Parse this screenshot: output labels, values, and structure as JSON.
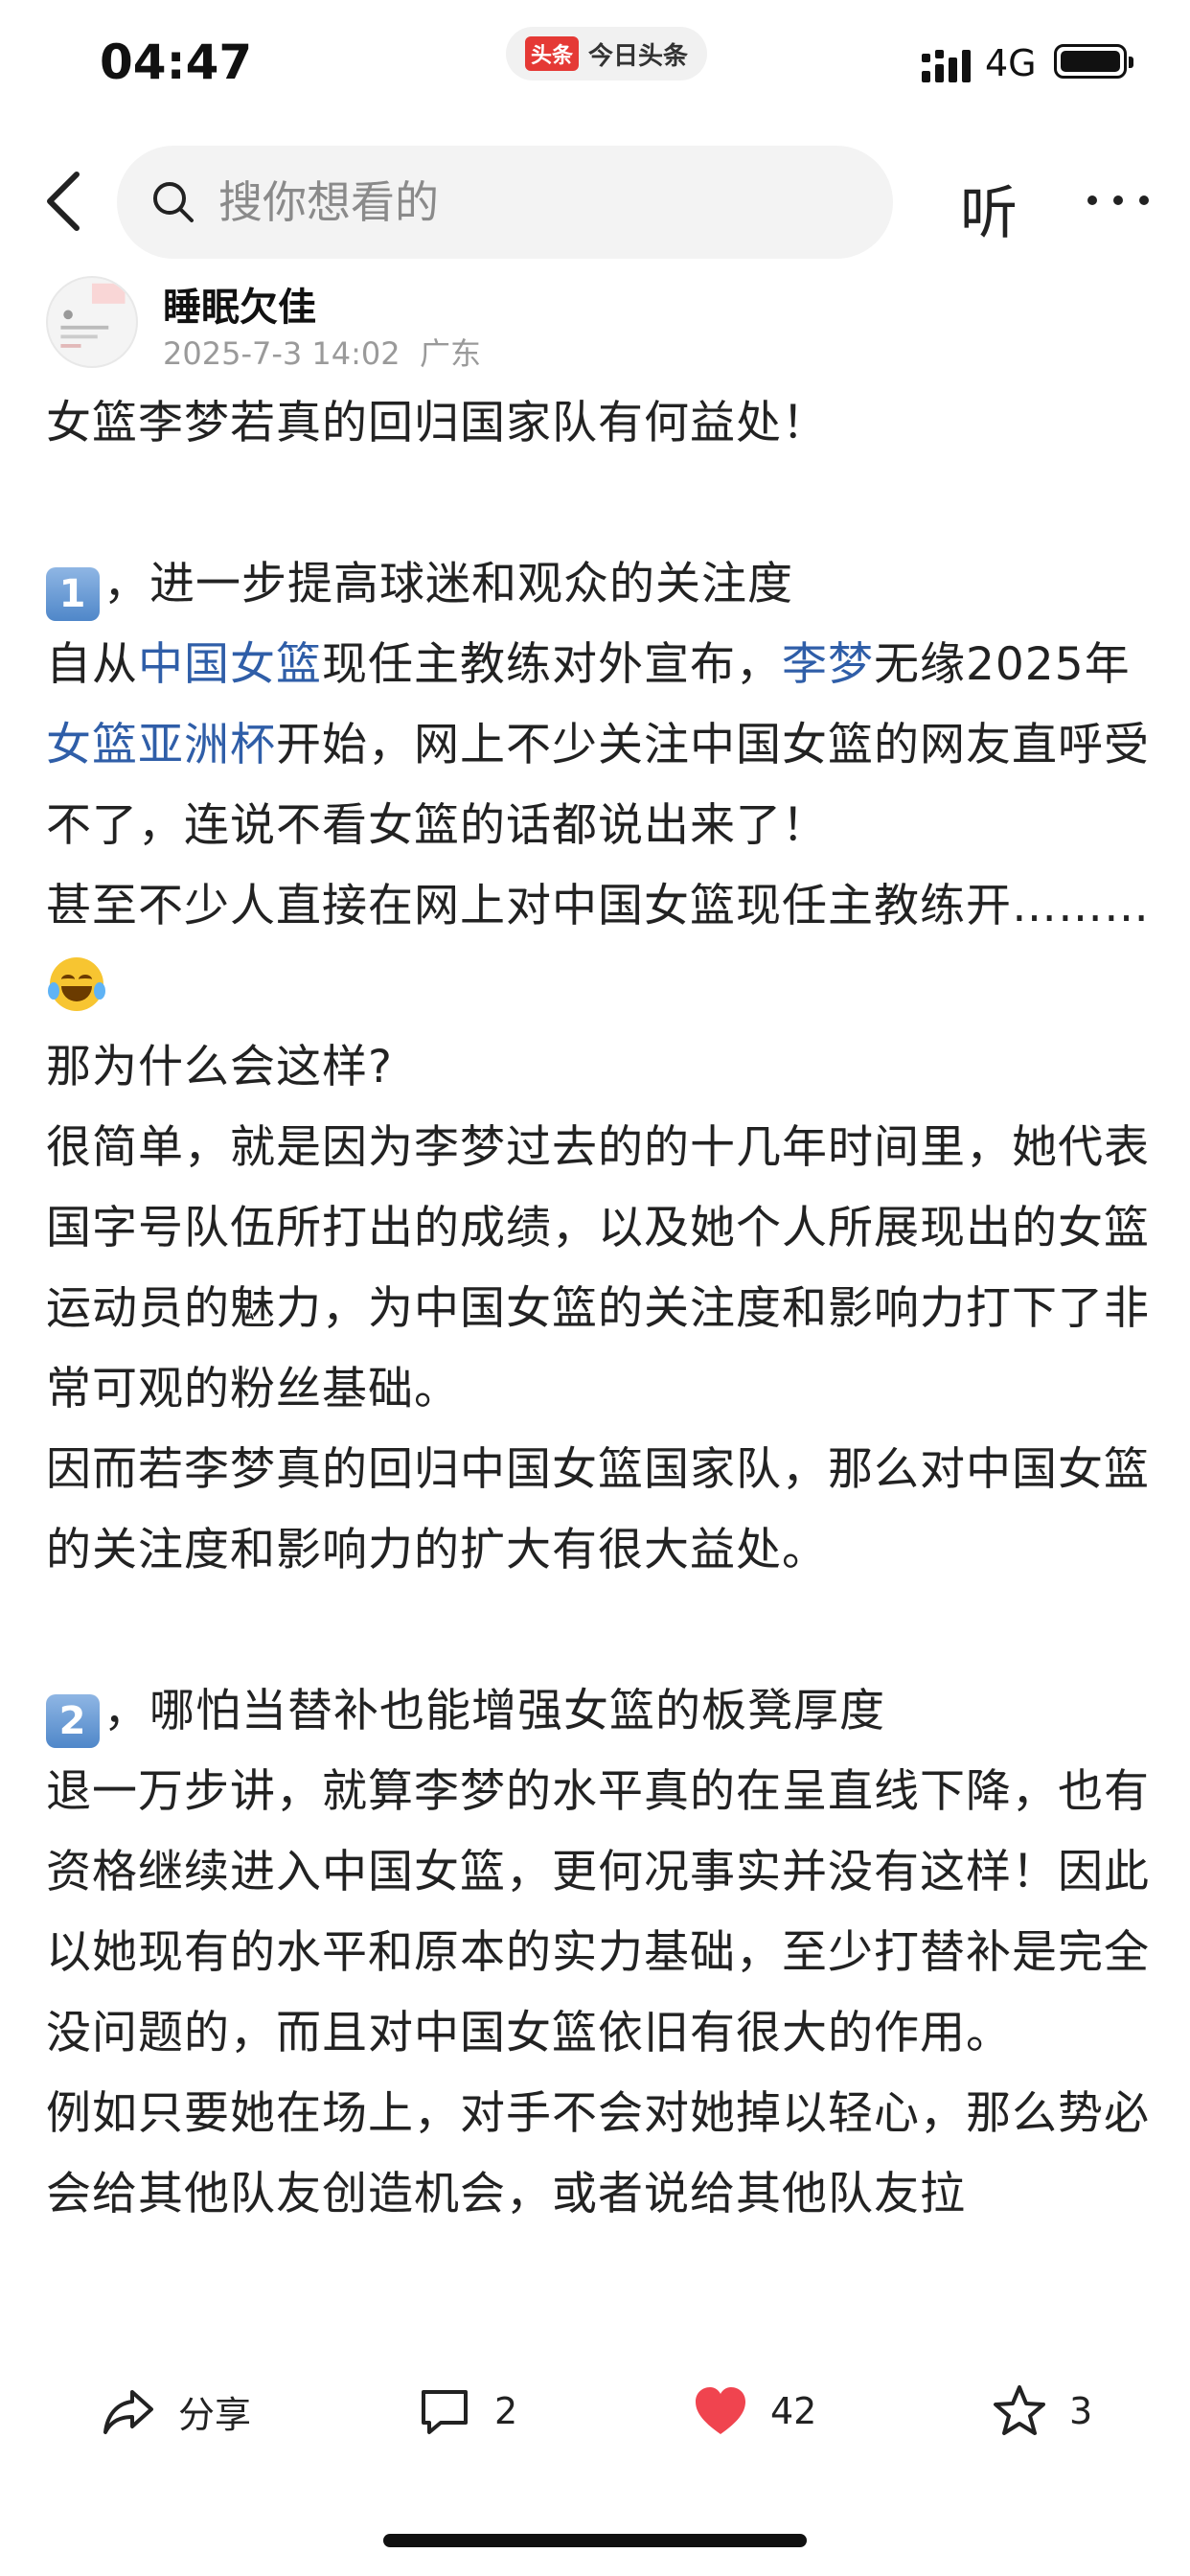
{
  "status_bar": {
    "time": "04:47",
    "app_logo": "头条",
    "app_name": "今日头条",
    "network": "4G"
  },
  "nav": {
    "search_placeholder": "搜你想看的",
    "listen_label": "听",
    "back_icon": "chevron-left-icon",
    "more_icon": "more-dots-icon"
  },
  "author": {
    "name": "睡眠欠佳",
    "date": "2025-7-3 14:02",
    "location": "广东"
  },
  "article": {
    "title": "女篮李梦若真的回归国家队有何益处！",
    "s1_num": "1",
    "s1_heading": "，进一步提高球迷和观众的关注度",
    "p1_a": "自从",
    "p1_link1": "中国女篮",
    "p1_b": "现任主教练对外宣布，",
    "p1_link2": "李梦",
    "p1_c": "无缘2025年",
    "p1_link3": "女篮亚洲杯",
    "p1_d": "开始，网上不少关注中国女篮的网友直呼受不了，连说不看女篮的话都说出来了！",
    "p2": "甚至不少人直接在网上对中国女篮现任主教练开………",
    "p3": "那为什么会这样?",
    "p4": "很简单，就是因为李梦过去的的十几年时间里，她代表国字号队伍所打出的成绩，以及她个人所展现出的女篮运动员的魅力，为中国女篮的关注度和影响力打下了非常可观的粉丝基础。",
    "p5": "因而若李梦真的回归中国女篮国家队，那么对中国女篮的关注度和影响力的扩大有很大益处。",
    "s2_num": "2",
    "s2_heading": "，哪怕当替补也能增强女篮的板凳厚度",
    "p6": "退一万步讲，就算李梦的水平真的在呈直线下降，也有资格继续进入中国女篮，更何况事实并没有这样！因此以她现有的水平和原本的实力基础，至少打替补是完全没问题的，而且对中国女篮依旧有很大的作用。",
    "p7": "例如只要她在场上，对手不会对她掉以轻心，那么势必会给其他队友创造机会，或者说给其他队友拉"
  },
  "bottom_bar": {
    "share_label": "分享",
    "comment_count": "2",
    "like_count": "42",
    "favorite_count": "3",
    "like_color": "#f0444f"
  }
}
